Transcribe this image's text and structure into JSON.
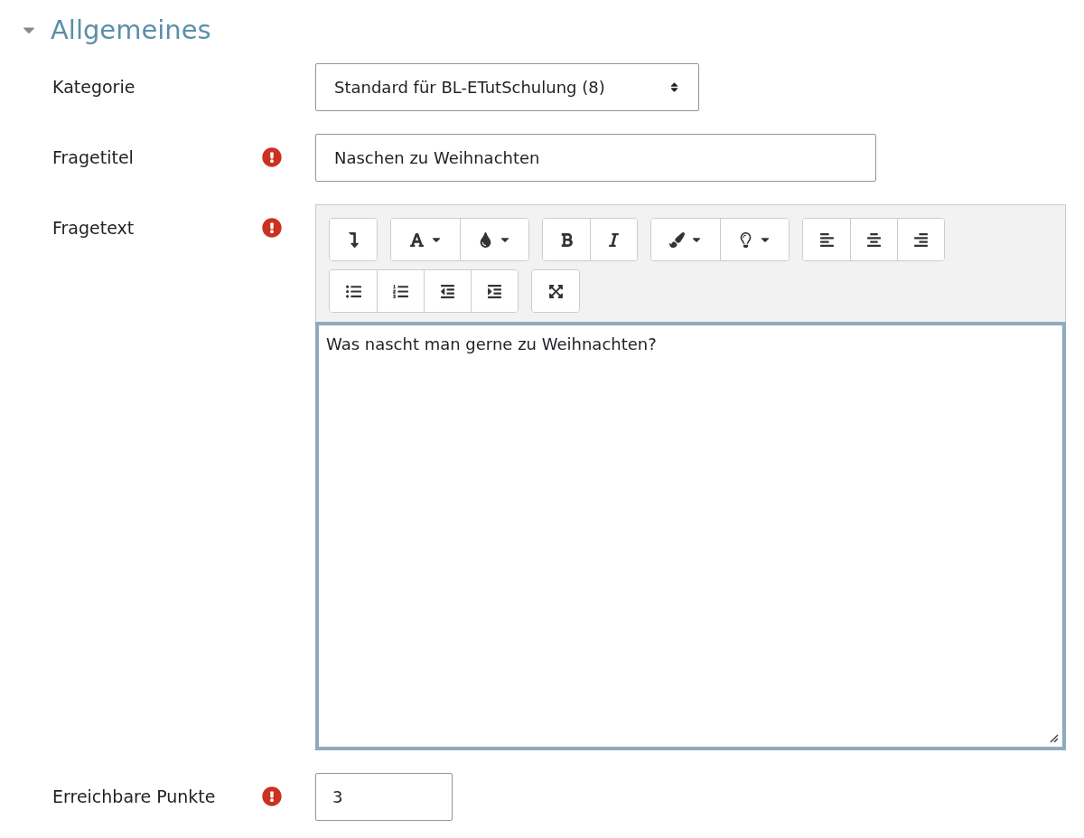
{
  "section": {
    "title": "Allgemeines",
    "expanded": true
  },
  "fields": [
    {
      "kind": "select",
      "label": "Kategorie",
      "required": false,
      "value": "Standard für BL-ETutSchulung (8)"
    },
    {
      "kind": "text",
      "label": "Fragetitel",
      "required": true,
      "value": "Naschen zu Weihnachten"
    },
    {
      "kind": "editor",
      "label": "Fragetext",
      "required": true,
      "value": "Was nascht man gerne zu Weihnachten?"
    },
    {
      "kind": "number",
      "label": "Erreichbare Punkte",
      "required": true,
      "value": "3"
    }
  ]
}
